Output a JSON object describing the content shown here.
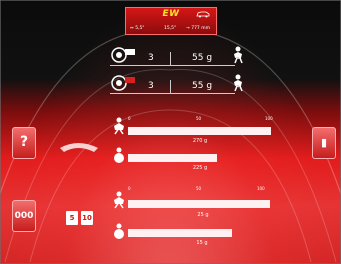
{
  "header": {
    "mode_title": "EW",
    "info_left": "↔ 5,5\"",
    "info_mid": "15,5\"",
    "info_right": "→ 777 mm"
  },
  "wheel_rows": [
    {
      "count": "3",
      "weight": "55 g"
    },
    {
      "count": "3",
      "weight": "55 g"
    }
  ],
  "side_buttons": {
    "left_top": "?",
    "left_bottom": "000",
    "right_top": "▮"
  },
  "chips": {
    "a": "5",
    "b": "10"
  },
  "scales": {
    "upper": [
      "0",
      "50",
      "100"
    ],
    "lower": [
      "0",
      "50",
      "100"
    ]
  },
  "bars": [
    {
      "value_text": "270 g",
      "fraction": 1.0
    },
    {
      "value_text": "225 g",
      "fraction": 0.62
    },
    {
      "value_text": "25 g",
      "fraction": 0.99
    },
    {
      "value_text": "15 g",
      "fraction": 0.8
    }
  ],
  "colors": {
    "accent": "#e21c1c",
    "title": "#ffe32a"
  },
  "icons": {
    "top_car": "car-icon",
    "wheel_inner": "wheel-inner-icon",
    "wheel_outer": "wheel-outer-icon",
    "person_hammer": "person-hammer-icon",
    "person_adhesive": "person-adhesive-icon",
    "help": "help-icon",
    "counter": "counter-icon",
    "book": "book-icon"
  }
}
